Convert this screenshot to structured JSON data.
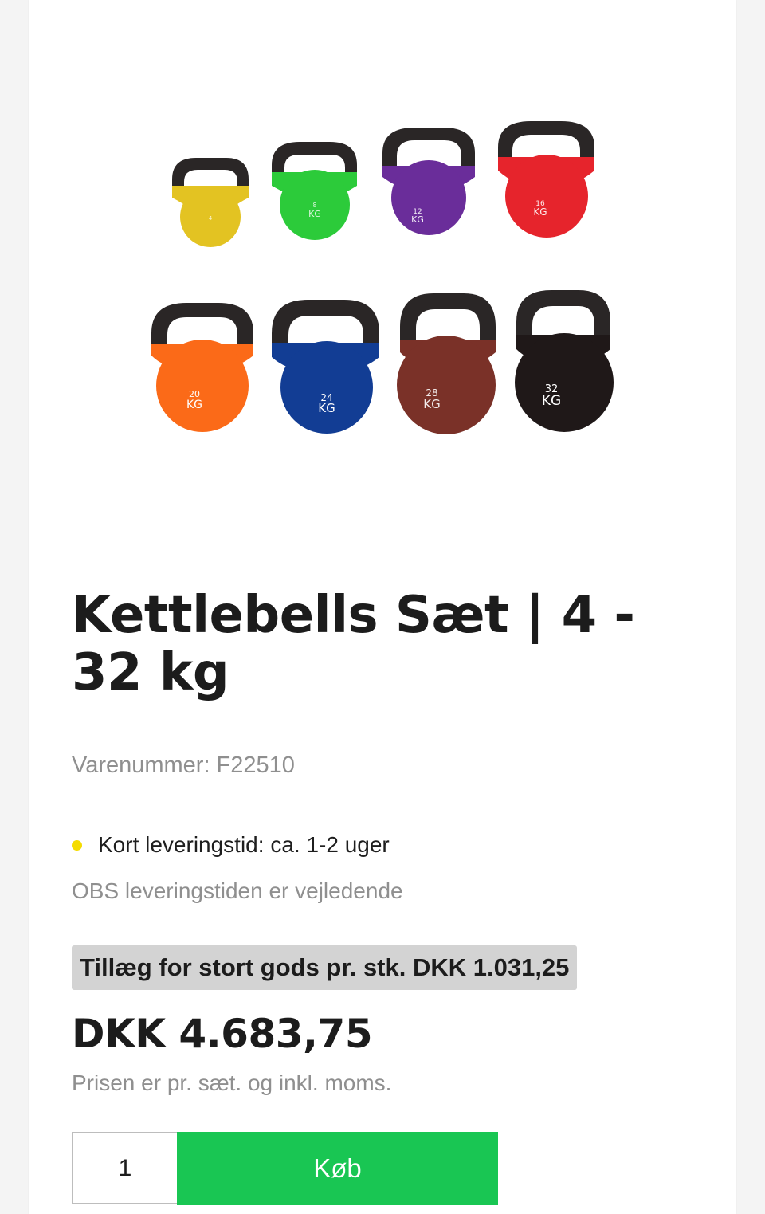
{
  "product": {
    "image_alt": "Kettlebells set",
    "title": "Kettlebells Sæt | 4 - 32 kg",
    "sku_label": "Varenummer:",
    "sku_value": "F22510",
    "stock_text": "Kort leveringstid: ca. 1-2 uger",
    "delivery_note": "OBS leveringstiden er vejledende",
    "surcharge_text": "Tillæg for stort gods pr. stk. DKK 1.031,25",
    "price": "DKK 4.683,75",
    "price_note": "Prisen er pr. sæt. og inkl. moms.",
    "quantity": "1",
    "buy_label": "Køb"
  },
  "kettlebells": [
    {
      "weight": "4",
      "unit": "KG",
      "color": "#e3c322"
    },
    {
      "weight": "8",
      "unit": "KG",
      "color": "#2ccb3a"
    },
    {
      "weight": "12",
      "unit": "KG",
      "color": "#6a2d9a"
    },
    {
      "weight": "16",
      "unit": "KG",
      "color": "#e6242c"
    },
    {
      "weight": "20",
      "unit": "KG",
      "color": "#fb6a18"
    },
    {
      "weight": "24",
      "unit": "KG",
      "color": "#123d94"
    },
    {
      "weight": "28",
      "unit": "KG",
      "color": "#7a3128"
    },
    {
      "weight": "32",
      "unit": "KG",
      "color": "#1f1818"
    }
  ],
  "colors": {
    "stock_dot": "#f5dc00",
    "buy_button": "#19c653",
    "surcharge_bg": "#d3d3d3",
    "handle": "#2a2626"
  }
}
